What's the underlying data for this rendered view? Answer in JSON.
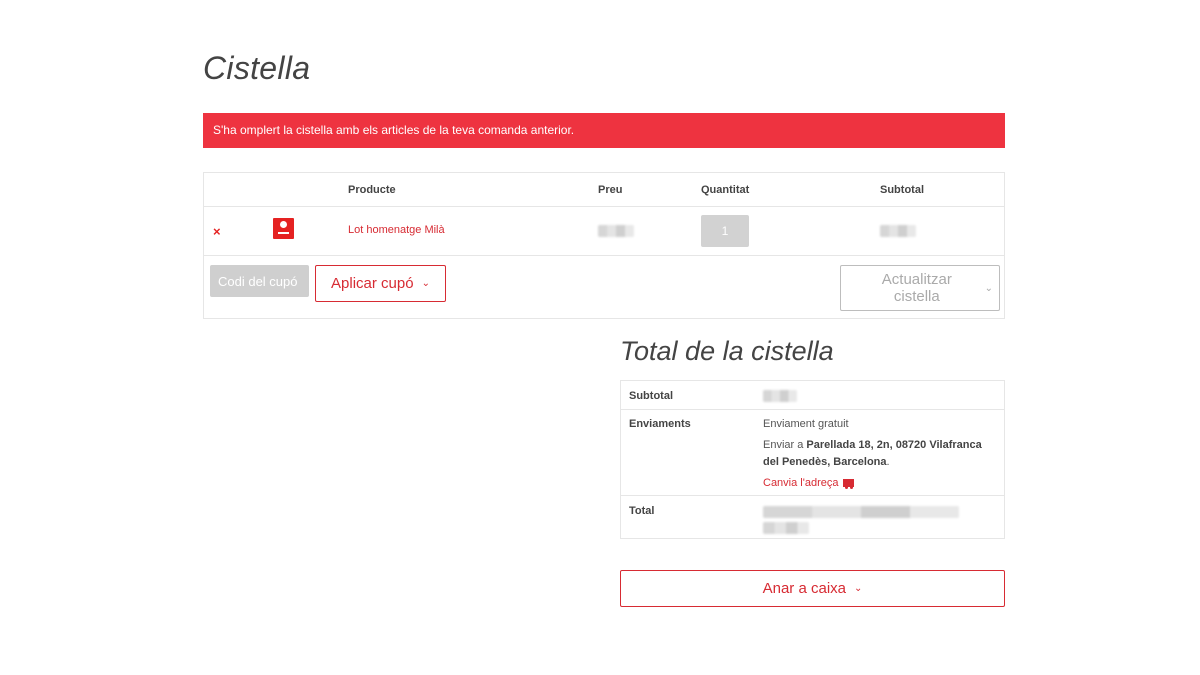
{
  "page": {
    "title": "Cistella"
  },
  "notice": {
    "text": "S'ha omplert la cistella amb els articles de la teva comanda anterior."
  },
  "cart": {
    "headers": {
      "product": "Producte",
      "price": "Preu",
      "quantity": "Quantitat",
      "subtotal": "Subtotal"
    },
    "items": [
      {
        "name": "Lot homenatge Milà",
        "quantity": "1"
      }
    ],
    "remove_symbol": "×",
    "coupon_placeholder": "Codi del cupó",
    "apply_coupon_label": "Aplicar cupó",
    "update_cart_label": "Actualitzar cistella",
    "chevron": "⌄"
  },
  "totals": {
    "title": "Total de la cistella",
    "subtotal_label": "Subtotal",
    "shipping_label": "Enviaments",
    "shipping_method": "Enviament gratuit",
    "ship_to_prefix": "Enviar a ",
    "ship_to_address": "Parellada 18, 2n, 08720 Vilafranca del Penedès, Barcelona",
    "ship_to_suffix": ".",
    "change_address": "Canvia l'adreça",
    "total_label": "Total"
  },
  "checkout": {
    "label": "Anar a caixa"
  },
  "colors": {
    "accent": "#ee3340",
    "link": "#d72b33"
  },
  "icons": [
    "remove-icon",
    "truck-icon",
    "chevron-down-icon"
  ]
}
